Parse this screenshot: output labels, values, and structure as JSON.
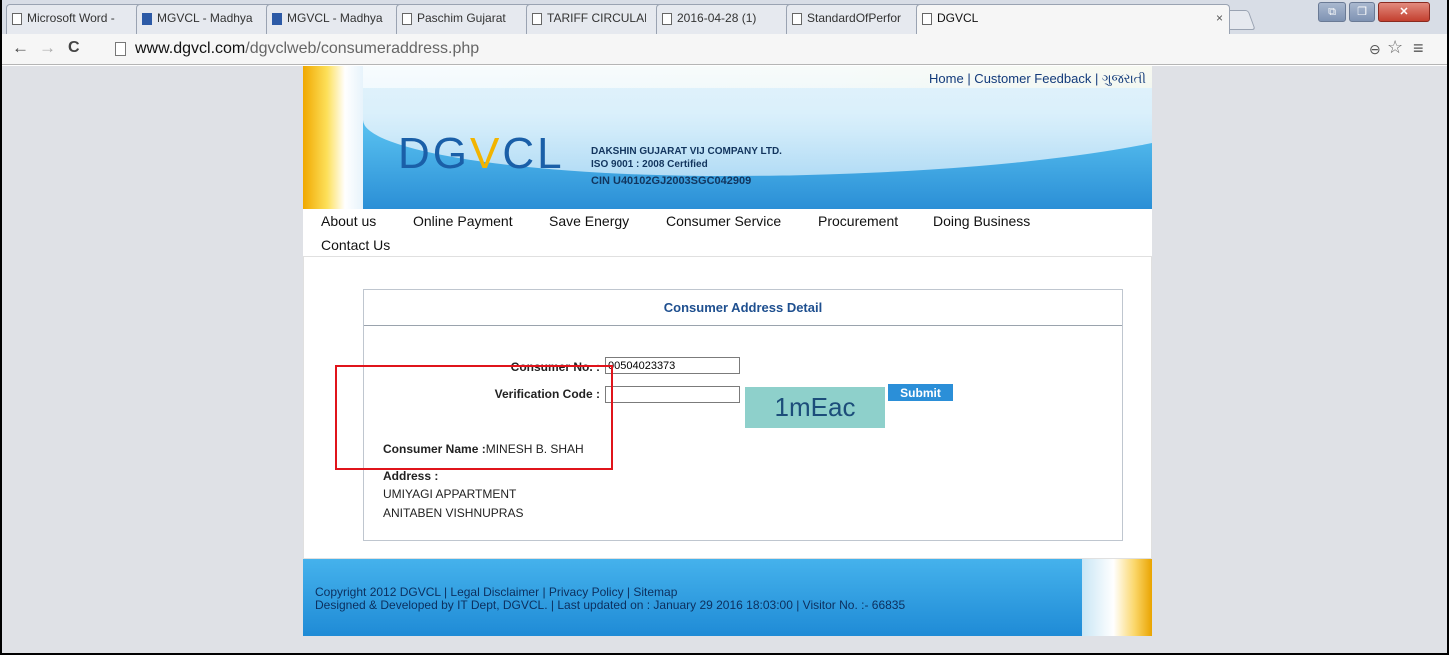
{
  "browser": {
    "tabs": [
      {
        "label": "Microsoft Word -",
        "icon": "page-icon"
      },
      {
        "label": "MGVCL - Madhya",
        "icon": "mgvcl-favicon"
      },
      {
        "label": "MGVCL - Madhya",
        "icon": "mgvcl-favicon"
      },
      {
        "label": "Paschim Gujarat",
        "icon": "page-icon"
      },
      {
        "label": "TARIFF CIRCULAR",
        "icon": "page-icon"
      },
      {
        "label": "2016-04-28 (1)",
        "icon": "page-icon"
      },
      {
        "label": "StandardOfPerfor",
        "icon": "page-icon"
      },
      {
        "label": "DGVCL",
        "icon": "page-icon",
        "active": true
      }
    ],
    "tab_close": "×",
    "back": "←",
    "forward": "→",
    "reload": "C",
    "url_host": "www.dgvcl.com",
    "url_path": "/dgvclweb/consumeraddress.php",
    "zoom_icon": "⊖",
    "star_icon": "☆",
    "menu_icon": "≡",
    "win_minimize": "▁",
    "win_restore": "❐",
    "win_close": "✕",
    "win_restore_small": "⧉"
  },
  "site": {
    "toplinks": "Home | Customer Feedback | ગુજરાતી",
    "logo": {
      "left": "DG",
      "bolt": "V",
      "right": "CL"
    },
    "company_name": "DAKSHIN GUJARAT VIJ COMPANY LTD.",
    "iso": "ISO 9001 : 2008 Certified",
    "cin": "CIN U40102GJ2003SGC042909",
    "menu": [
      "About us",
      "Online Payment",
      "Save Energy",
      "Consumer Service",
      "Procurement",
      "Doing Business",
      "Contact Us"
    ],
    "colors": {
      "accent": "#2b8fd8",
      "title": "#1e4f8f",
      "highlight": "#e0141b"
    }
  },
  "form": {
    "title": "Consumer Address Detail",
    "consumer_no_label": "Consumer No. :",
    "consumer_no_value": "00504023373",
    "verification_label": "Verification Code :",
    "verification_value": "",
    "captcha": "1mEac",
    "submit": "Submit"
  },
  "result": {
    "name_label": "Consumer Name :",
    "name_value": "MINESH B. SHAH",
    "address_label": "Address :",
    "address_lines": [
      "UMIYAGI APPARTMENT",
      "ANITABEN VISHNUPRAS"
    ]
  },
  "footer": {
    "line1": "Copyright 2012 DGVCL | Legal Disclaimer | Privacy Policy | Sitemap",
    "line2": "Designed & Developed by IT Dept, DGVCL. | Last updated on : January 29 2016 18:03:00 | Visitor No. :- 66835"
  }
}
